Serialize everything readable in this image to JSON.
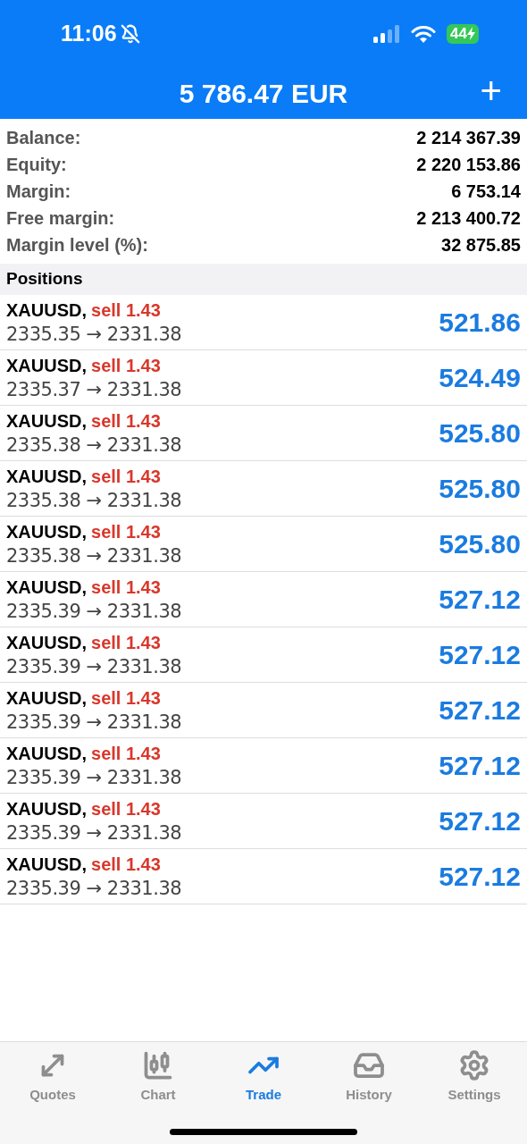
{
  "status_bar": {
    "time": "11:06",
    "battery": "44"
  },
  "header": {
    "title": "5 786.47 EUR",
    "add_label": "+"
  },
  "summary": [
    {
      "label": "Balance:",
      "value": "2 214 367.39"
    },
    {
      "label": "Equity:",
      "value": "2 220 153.86"
    },
    {
      "label": "Margin:",
      "value": "6 753.14"
    },
    {
      "label": "Free margin:",
      "value": "2 213 400.72"
    },
    {
      "label": "Margin level (%):",
      "value": "32 875.85"
    }
  ],
  "positions": {
    "title": "Positions",
    "rows": [
      {
        "symbol": "XAUUSD,",
        "side": "sell 1.43",
        "prices": "2335.35 → 2331.38",
        "profit": "521.86"
      },
      {
        "symbol": "XAUUSD,",
        "side": "sell 1.43",
        "prices": "2335.37 → 2331.38",
        "profit": "524.49"
      },
      {
        "symbol": "XAUUSD,",
        "side": "sell 1.43",
        "prices": "2335.38 → 2331.38",
        "profit": "525.80"
      },
      {
        "symbol": "XAUUSD,",
        "side": "sell 1.43",
        "prices": "2335.38 → 2331.38",
        "profit": "525.80"
      },
      {
        "symbol": "XAUUSD,",
        "side": "sell 1.43",
        "prices": "2335.38 → 2331.38",
        "profit": "525.80"
      },
      {
        "symbol": "XAUUSD,",
        "side": "sell 1.43",
        "prices": "2335.39 → 2331.38",
        "profit": "527.12"
      },
      {
        "symbol": "XAUUSD,",
        "side": "sell 1.43",
        "prices": "2335.39 → 2331.38",
        "profit": "527.12"
      },
      {
        "symbol": "XAUUSD,",
        "side": "sell 1.43",
        "prices": "2335.39 → 2331.38",
        "profit": "527.12"
      },
      {
        "symbol": "XAUUSD,",
        "side": "sell 1.43",
        "prices": "2335.39 → 2331.38",
        "profit": "527.12"
      },
      {
        "symbol": "XAUUSD,",
        "side": "sell 1.43",
        "prices": "2335.39 → 2331.38",
        "profit": "527.12"
      },
      {
        "symbol": "XAUUSD,",
        "side": "sell 1.43",
        "prices": "2335.39 → 2331.38",
        "profit": "527.12"
      }
    ]
  },
  "tabs": [
    {
      "label": "Quotes",
      "selected": false
    },
    {
      "label": "Chart",
      "selected": false
    },
    {
      "label": "Trade",
      "selected": true
    },
    {
      "label": "History",
      "selected": false
    },
    {
      "label": "Settings",
      "selected": false
    }
  ]
}
